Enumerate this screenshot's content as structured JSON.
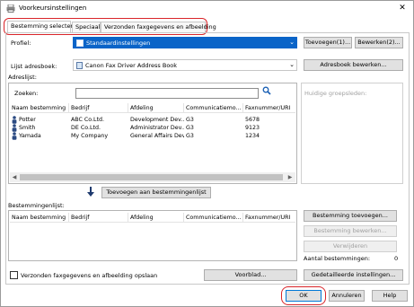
{
  "window": {
    "title": "Voorkeursinstellingen"
  },
  "tabs": [
    "Bestemming selecteren",
    "Speciaal",
    "Verzonden faxgegevens en afbeelding"
  ],
  "profile": {
    "label": "Profiel:",
    "value": "Standaardinstellingen",
    "add_label": "Toevoegen(1)...",
    "edit_label": "Bewerken(2)..."
  },
  "addressbook": {
    "list_label": "Lijst adresboek:",
    "value": "Canon Fax Driver Address Book",
    "edit_label": "Adresboek bewerken...",
    "addresslist_label": "Adreslijst:"
  },
  "search": {
    "label": "Zoeken:",
    "value": ""
  },
  "columns": [
    "Naam bestemming",
    "Bedrijf",
    "Afdeling",
    "Communicatiemo...",
    "Faxnummer/URI"
  ],
  "contacts": [
    {
      "name": "Potter",
      "company": "ABC Co.Ltd.",
      "department": "Development Dev...",
      "mode": "G3",
      "fax": "5678"
    },
    {
      "name": "Smith",
      "company": "DE Co.Ltd.",
      "department": "Administrator Dev...",
      "mode": "G3",
      "fax": "9123"
    },
    {
      "name": "Yamada",
      "company": "My Company",
      "department": "General Affairs Dev...",
      "mode": "G3",
      "fax": "1234"
    }
  ],
  "groups_label": "Huidige groepsleden:",
  "add_to_list_label": "Toevoegen aan bestemmingenlijst",
  "destlist": {
    "label": "Bestemmingenlijst:",
    "add_label": "Bestemming toevoegen...",
    "edit_label": "Bestemming bewerken...",
    "delete_label": "Verwijderen",
    "count_label": "Aantal bestemmingen:",
    "count_value": "0"
  },
  "save_checkbox_label": "Verzonden faxgegevens en afbeelding opslaan",
  "cover_label": "Voorblad...",
  "detailed_label": "Gedetailleerde instellingen...",
  "footer": {
    "ok": "OK",
    "cancel": "Annuleren",
    "help": "Help"
  },
  "colors": {
    "accent": "#d9252a",
    "selection": "#0a64c8"
  }
}
